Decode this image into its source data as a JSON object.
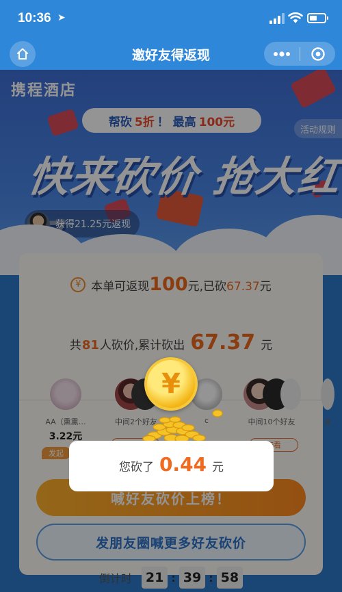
{
  "status_bar": {
    "time": "10:36"
  },
  "nav": {
    "title": "邀好友得返现"
  },
  "banner": {
    "brand": "携程酒店",
    "pill_prefix": "帮砍",
    "pill_highlight": "5折",
    "pill_middle": "！ 最高",
    "pill_amount": "100元",
    "rules_label": "活动规则",
    "slogan": "快来砍价 抢大红包",
    "reward_text": "获得21.25元返现"
  },
  "card": {
    "rebate_prefix": "本单可返现",
    "rebate_amount": "100",
    "rebate_mid": "元,已砍",
    "rebate_cut": "67.37",
    "rebate_suffix": "元",
    "total_prefix": "共",
    "total_count": "81",
    "total_mid": "人砍价,累计砍出",
    "total_sum": "67.37",
    "total_suffix": "元",
    "friends": [
      {
        "label": "AA（熏熏…",
        "value": "3.22元"
      },
      {
        "label": "中间2个好友"
      },
      {
        "label": "c"
      },
      {
        "label": "中间10个好友"
      },
      {
        "label": "宜"
      }
    ],
    "initiator_tag": "发起",
    "view_label": "查看",
    "rank_button": "喊好友砍价上榜！",
    "share_button": "发朋友圈喊更多好友砍价",
    "countdown_label": "倒计时",
    "countdown": {
      "hours": "21",
      "minutes": "39",
      "seconds": "58"
    }
  },
  "dialog": {
    "prefix": "您砍了",
    "amount": "0.44",
    "suffix": "元"
  },
  "colors": {
    "nav_blue": "#2f87da",
    "orange": "#f06a1f",
    "button_orange": "#ff9a25",
    "share_blue": "#2d73c8"
  }
}
